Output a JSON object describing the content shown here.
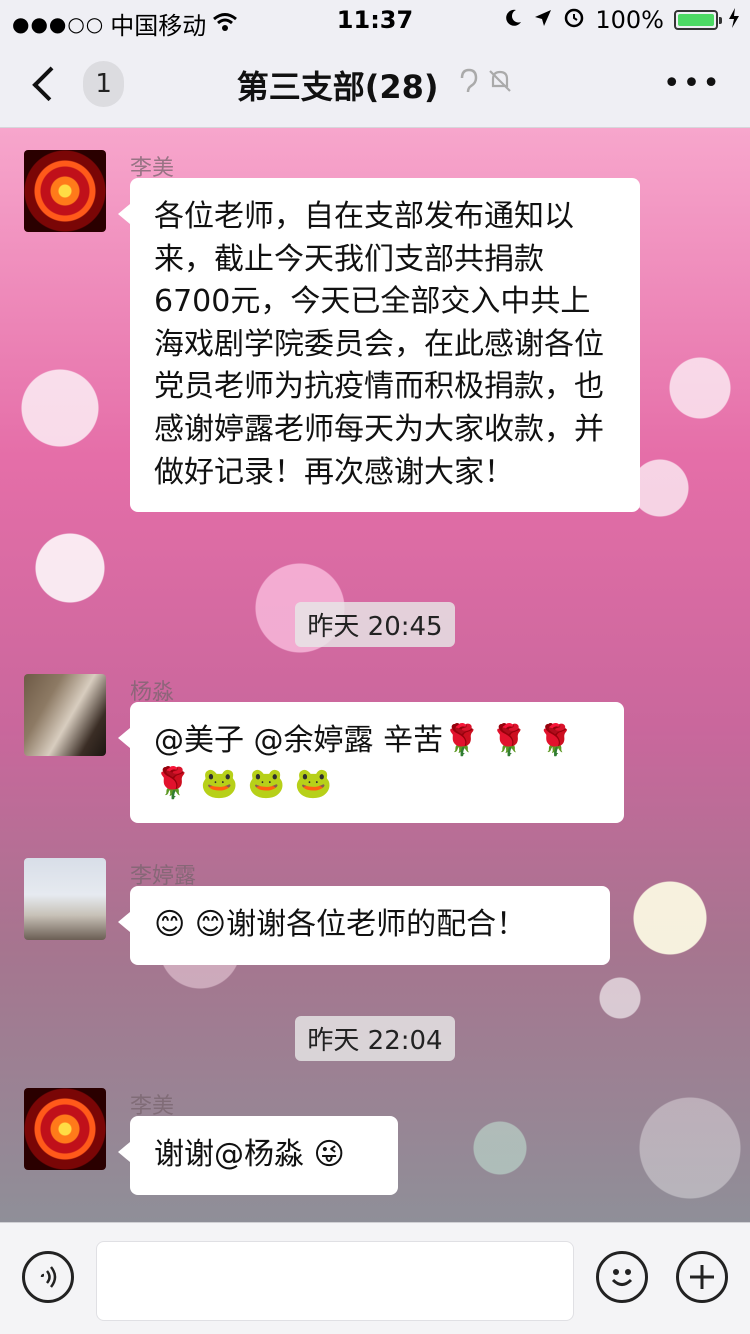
{
  "status_bar": {
    "signal": "●●●○○",
    "carrier": "中国移动",
    "wifi_icon": "wifi-icon",
    "time": "11:37",
    "battery_percent": "100%"
  },
  "nav": {
    "back_count": "1",
    "title": "第三支部(28)",
    "more_label": "•••"
  },
  "messages": [
    {
      "sender": "李美",
      "text": "各位老师，自在支部发布通知以来，截止今天我们支部共捐款6700元，今天已全部交入中共上海戏剧学院委员会，在此感谢各位党员老师为抗疫情而积极捐款，也感谢婷露老师每天为大家收款，并做好记录！再次感谢大家！"
    },
    {
      "sender": "杨淼",
      "text": "@美子 @余婷露 辛苦🌹 🌹 🌹 🌹 🐸 🐸 🐸"
    },
    {
      "sender": "李婷露",
      "text": "😊 😊谢谢各位老师的配合！"
    },
    {
      "sender": "李美",
      "text": "谢谢@杨淼 😜"
    }
  ],
  "timestamps": [
    "昨天 20:45",
    "昨天 22:04"
  ],
  "input_bar": {
    "voice_icon": "voice-icon",
    "emoji_icon": "emoji-icon",
    "plus_icon": "plus-icon"
  }
}
